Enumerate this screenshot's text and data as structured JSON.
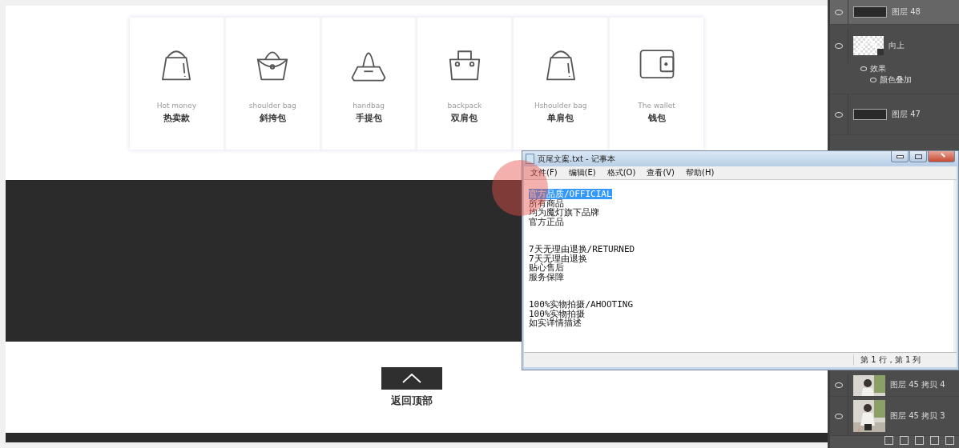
{
  "categories": [
    {
      "kind": "tote",
      "label_en": "Hot money",
      "label_zh": "热卖款"
    },
    {
      "kind": "shoulder",
      "label_en": "shoulder bag",
      "label_zh": "斜挎包"
    },
    {
      "kind": "handbag",
      "label_en": "handbag",
      "label_zh": "手提包"
    },
    {
      "kind": "basket",
      "label_en": "backpack",
      "label_zh": "双肩包"
    },
    {
      "kind": "tote",
      "label_en": "Hshoulder bag",
      "label_zh": "单肩包"
    },
    {
      "kind": "wallet",
      "label_en": "The wallet",
      "label_zh": "钱包"
    }
  ],
  "back_to_top": {
    "label": "返回顶部"
  },
  "notepad": {
    "title": "页尾文案.txt - 记事本",
    "menu": [
      "文件(F)",
      "编辑(E)",
      "格式(O)",
      "查看(V)",
      "帮助(H)"
    ],
    "paragraphs": [
      {
        "lines": [
          {
            "text": "官方品质/OFFICIAL",
            "selected": true
          },
          {
            "text": "所有商品",
            "selected": false
          },
          {
            "text": "均为魔灯旗下品牌",
            "selected": false
          },
          {
            "text": "官方正品",
            "selected": false
          }
        ]
      },
      {
        "lines": [
          {
            "text": "7天无理由退换/RETURNED",
            "selected": false
          },
          {
            "text": "7天无理由退换",
            "selected": false
          },
          {
            "text": "贴心售后",
            "selected": false
          },
          {
            "text": "服务保障",
            "selected": false
          }
        ]
      },
      {
        "lines": [
          {
            "text": "100%实物拍摄/AHOOTING",
            "selected": false
          },
          {
            "text": "100%实物拍摄",
            "selected": false
          },
          {
            "text": "如实详情描述",
            "selected": false
          }
        ]
      }
    ],
    "status": "第 1 行，第 1 列"
  },
  "layers": [
    {
      "name": "图层 48",
      "kind": "dark",
      "selected": true,
      "visible": true
    },
    {
      "name": "向上",
      "kind": "pattern",
      "selected": false,
      "visible": true,
      "children": [
        {
          "name": "效果",
          "visible": true,
          "children": [
            {
              "name": "颜色叠加",
              "visible": true
            }
          ]
        }
      ]
    },
    {
      "name": "图层 47",
      "kind": "dark",
      "selected": false,
      "visible": true
    },
    {
      "name": "图层 45 拷贝 4",
      "selected": false,
      "visible": true
    },
    {
      "name": "图层 45 拷贝 3",
      "selected": false,
      "visible": true
    }
  ]
}
